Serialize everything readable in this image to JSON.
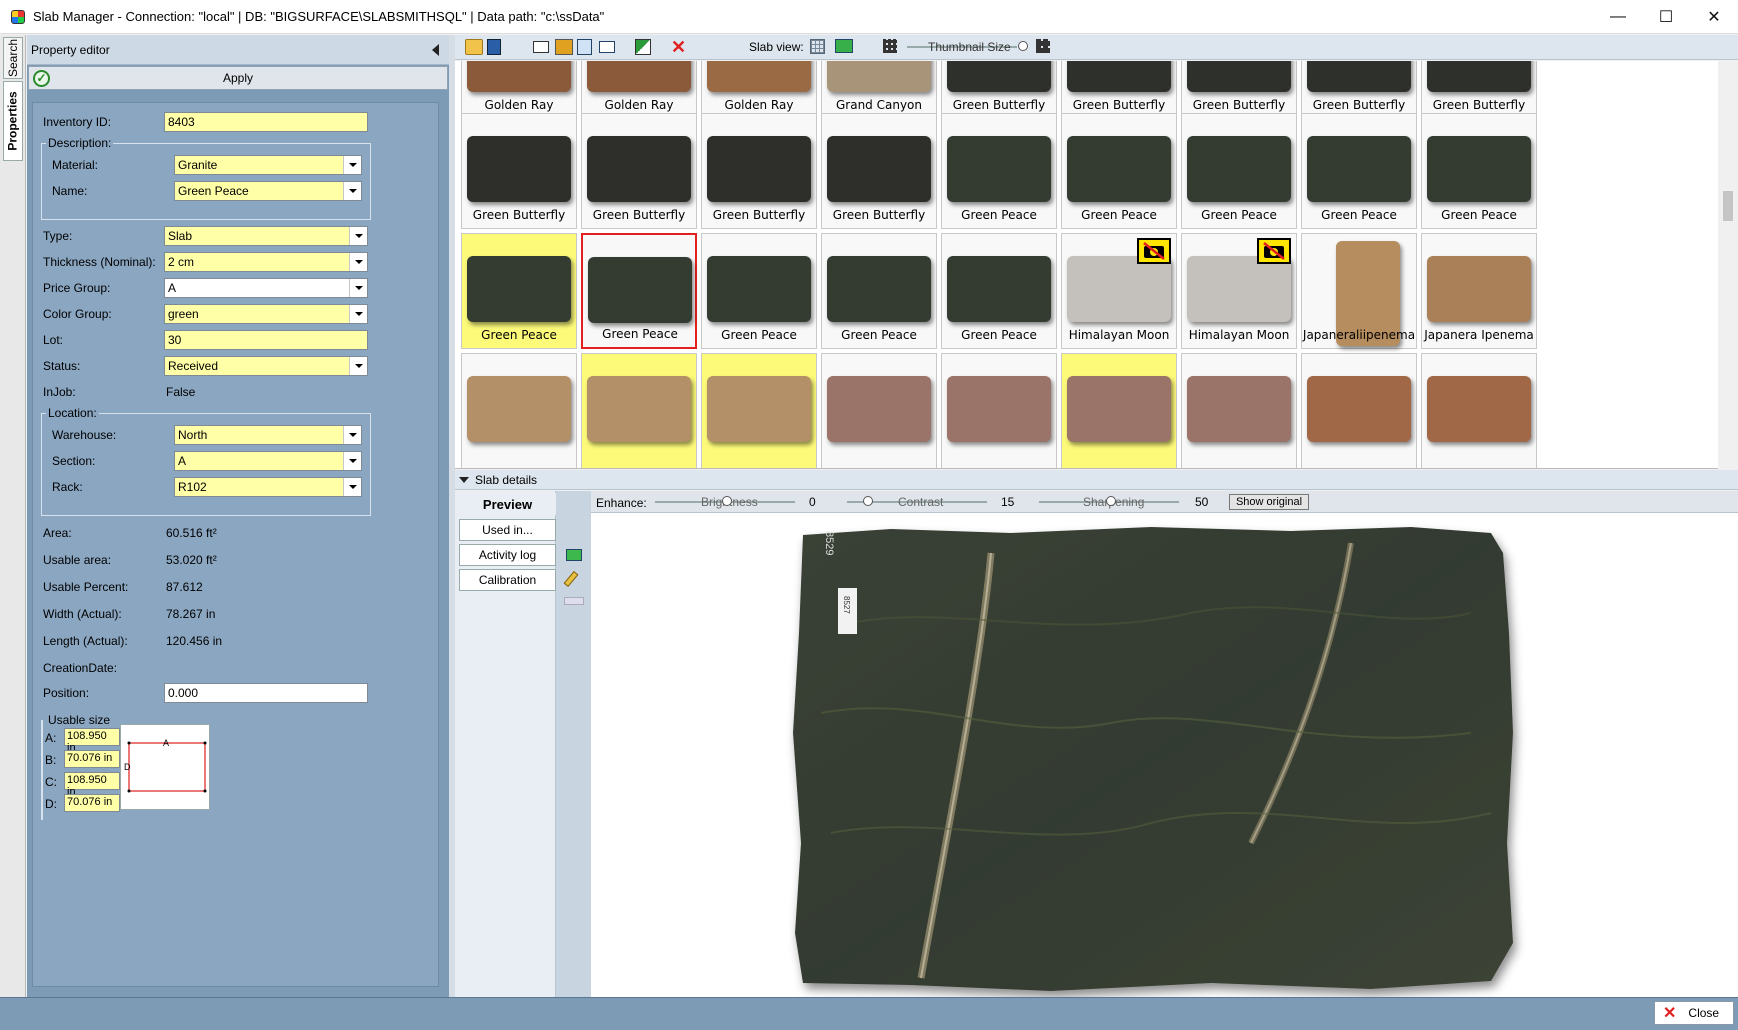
{
  "window": {
    "title": "Slab Manager -  Connection: \"local\"  |  DB: \"BIGSURFACE\\SLABSMITHSQL\"  |  Data path: \"c:\\ssData\"",
    "minimize_label": "—",
    "maximize_label": "☐",
    "close_label": "✕"
  },
  "side_tabs": {
    "search": "Search",
    "properties": "Properties"
  },
  "property_editor": {
    "header": "Property editor",
    "apply_label": "Apply",
    "inventory_id_label": "Inventory ID:",
    "inventory_id": "8403",
    "description_group": "Description:",
    "material_label": "Material:",
    "material": "Granite",
    "name_label": "Name:",
    "name": "Green Peace",
    "type_label": "Type:",
    "type": "Slab",
    "thickness_label": "Thickness (Nominal):",
    "thickness": "2 cm",
    "price_group_label": "Price Group:",
    "price_group": "A",
    "color_group_label": "Color Group:",
    "color_group": "green",
    "lot_label": "Lot:",
    "lot": "30",
    "status_label": "Status:",
    "status": "Received",
    "injob_label": "InJob:",
    "injob": "False",
    "location_group": "Location:",
    "warehouse_label": "Warehouse:",
    "warehouse": "North",
    "section_label": "Section:",
    "section": "A",
    "rack_label": "Rack:",
    "rack": "R102",
    "area_label": "Area:",
    "area": "60.516 ft²",
    "usable_area_label": "Usable area:",
    "usable_area": "53.020 ft²",
    "usable_percent_label": "Usable Percent:",
    "usable_percent": "87.612",
    "width_label": "Width (Actual):",
    "width": "78.267 in",
    "length_label": "Length (Actual):",
    "length": "120.456 in",
    "creation_date_label": "CreationDate:",
    "position_label": "Position:",
    "position": "0.000",
    "usable_size_group": "Usable size",
    "us_a_label": "A:",
    "us_a": "108.950 in",
    "us_b_label": "B:",
    "us_b": "70.076 in",
    "us_c_label": "C:",
    "us_c": "108.950 in",
    "us_d_label": "D:",
    "us_d": "70.076 in",
    "diagram_a": "A",
    "diagram_d": "D"
  },
  "toolbar": {
    "slab_view_label": "Slab view:",
    "thumbnail_size_label": "Thumbnail Size"
  },
  "gallery": [
    [
      {
        "name": "Golden Ray",
        "color": "#8a5a3a",
        "hl": false,
        "sel": false
      },
      {
        "name": "Golden Ray",
        "color": "#8a5a3a",
        "hl": false,
        "sel": false
      },
      {
        "name": "Golden Ray",
        "color": "#9a6a44",
        "hl": false,
        "sel": false
      },
      {
        "name": "Grand Canyon",
        "color": "#a89478",
        "hl": false,
        "sel": false
      },
      {
        "name": "Green Butterfly",
        "color": "#2e302c",
        "hl": false,
        "sel": false
      },
      {
        "name": "Green Butterfly",
        "color": "#2e302c",
        "hl": false,
        "sel": false
      },
      {
        "name": "Green Butterfly",
        "color": "#2e302c",
        "hl": false,
        "sel": false
      },
      {
        "name": "Green Butterfly",
        "color": "#2e302c",
        "hl": false,
        "sel": false
      },
      {
        "name": "Green Butterfly",
        "color": "#2e302c",
        "hl": false,
        "sel": false
      }
    ],
    [
      {
        "name": "Green Butterfly",
        "color": "#2e2f2b",
        "hl": false,
        "sel": false
      },
      {
        "name": "Green Butterfly",
        "color": "#2e2f2b",
        "hl": false,
        "sel": false
      },
      {
        "name": "Green Butterfly",
        "color": "#2e2f2b",
        "hl": false,
        "sel": false
      },
      {
        "name": "Green Butterfly",
        "color": "#2e2f2b",
        "hl": false,
        "sel": false
      },
      {
        "name": "Green Peace",
        "color": "#343c32",
        "hl": false,
        "sel": false
      },
      {
        "name": "Green Peace",
        "color": "#343c32",
        "hl": false,
        "sel": false
      },
      {
        "name": "Green Peace",
        "color": "#343c32",
        "hl": false,
        "sel": false
      },
      {
        "name": "Green Peace",
        "color": "#343c32",
        "hl": false,
        "sel": false
      },
      {
        "name": "Green Peace",
        "color": "#343c32",
        "hl": false,
        "sel": false
      }
    ],
    [
      {
        "name": "Green Peace",
        "color": "#343c32",
        "hl": true,
        "sel": false
      },
      {
        "name": "Green Peace",
        "color": "#343c32",
        "hl": false,
        "sel": true
      },
      {
        "name": "Green Peace",
        "color": "#343c32",
        "hl": false,
        "sel": false
      },
      {
        "name": "Green Peace",
        "color": "#343c32",
        "hl": false,
        "sel": false
      },
      {
        "name": "Green Peace",
        "color": "#343c32",
        "hl": false,
        "sel": false
      },
      {
        "name": "Himalayan Moon",
        "color": "#c4c0bc",
        "hl": false,
        "sel": false,
        "nophoto": true
      },
      {
        "name": "Himalayan Moon",
        "color": "#c4c0bc",
        "hl": false,
        "sel": false,
        "nophoto": true
      },
      {
        "name": "Japaneraliipenema",
        "color": "#b58d5e",
        "hl": false,
        "sel": false,
        "tall": true
      },
      {
        "name": "Japanera Ipenema",
        "color": "#a98058",
        "hl": false,
        "sel": false
      }
    ],
    [
      {
        "name": "",
        "color": "#b49068",
        "hl": false,
        "sel": false
      },
      {
        "name": "",
        "color": "#b49068",
        "hl": true,
        "sel": false
      },
      {
        "name": "",
        "color": "#b49068",
        "hl": true,
        "sel": false
      },
      {
        "name": "",
        "color": "#9a7468",
        "hl": false,
        "sel": false
      },
      {
        "name": "",
        "color": "#9a7468",
        "hl": false,
        "sel": false
      },
      {
        "name": "",
        "color": "#9a7468",
        "hl": true,
        "sel": false
      },
      {
        "name": "",
        "color": "#9a7468",
        "hl": false,
        "sel": false
      },
      {
        "name": "",
        "color": "#a16848",
        "hl": false,
        "sel": false
      },
      {
        "name": "",
        "color": "#a16848",
        "hl": false,
        "sel": false
      }
    ]
  ],
  "details": {
    "header": "Slab details",
    "tab_preview": "Preview",
    "tab_used_in": "Used in...",
    "tab_activity": "Activity log",
    "tab_calibration": "Calibration",
    "enhance_label": "Enhance:",
    "brightness_label": "Brightness",
    "brightness": "0",
    "contrast_label": "Contrast",
    "contrast": "15",
    "sharpening_label": "Sharpening",
    "sharpening": "50",
    "show_original_label": "Show original",
    "slab_tag": "8529",
    "slab_sticker": "8527"
  },
  "statusbar": {
    "close_label": "Close"
  }
}
